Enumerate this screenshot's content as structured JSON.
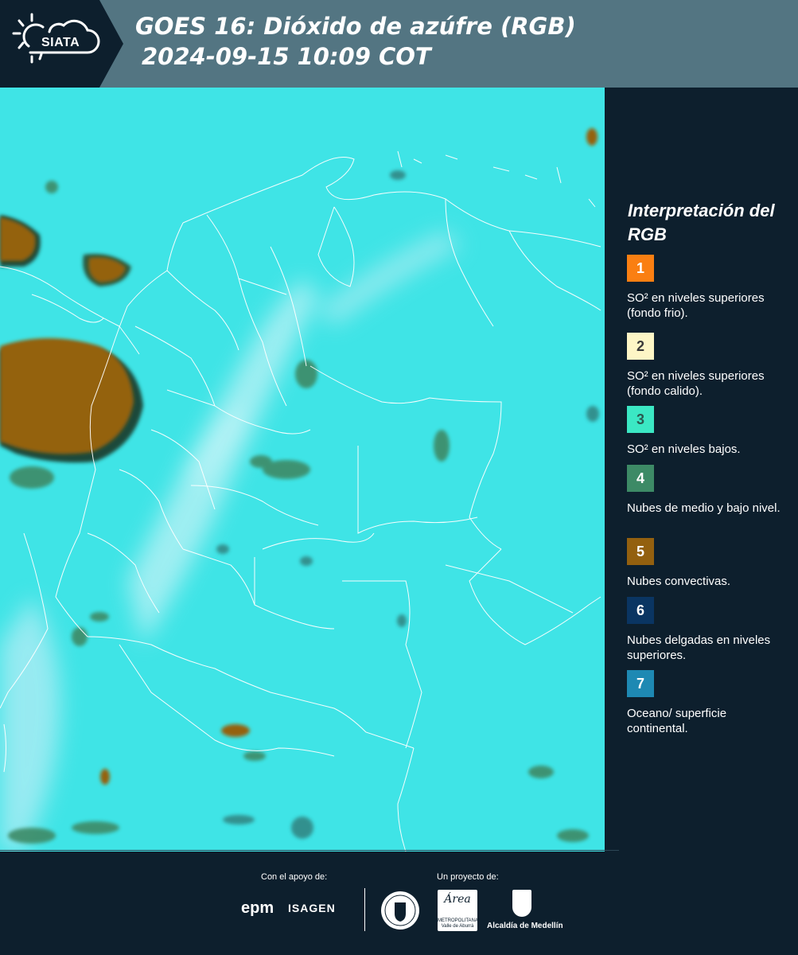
{
  "header": {
    "logo_text": "SIATA",
    "title_line1": "GOES 16: Dióxido de azúfre (RGB)",
    "title_line2": "2024-09-15 10:09 COT"
  },
  "legend": {
    "title": "Interpretación del RGB",
    "items": [
      {
        "number": "1",
        "label": "SO² en niveles superiores (fondo frio).",
        "color": "#fa7f12",
        "text_color": "#ffffff"
      },
      {
        "number": "2",
        "label": "SO² en niveles superiores (fondo calido).",
        "color": "#fdf6c6",
        "text_color": "#3a3a3a"
      },
      {
        "number": "3",
        "label": "SO² en niveles bajos.",
        "color": "#3be8c4",
        "text_color": "#2a5a50"
      },
      {
        "number": "4",
        "label": "Nubes de medio y bajo nivel.",
        "color": "#3d8a66",
        "text_color": "#ffffff"
      },
      {
        "number": "5",
        "label": "Nubes convectivas.",
        "color": "#93600f",
        "text_color": "#ffffff"
      },
      {
        "number": "6",
        "label": "Nubes delgadas en niveles superiores.",
        "color": "#0a3562",
        "text_color": "#ffffff"
      },
      {
        "number": "7",
        "label": "Oceano/ superficie continental.",
        "color": "#1e89b3",
        "text_color": "#ffffff"
      }
    ]
  },
  "footer": {
    "support_label": "Con el apoyo de:",
    "project_label": "Un proyecto de:",
    "sponsor_1": "epm",
    "sponsor_2": "ISAGEN",
    "partner_amva": "Área",
    "partner_amva_sub": "METROPOLITANA Valle de Aburrá",
    "partner_medellin": "Alcaldía de Medellín"
  },
  "map": {
    "colors": {
      "surface": "#3fe4e6",
      "convective": "#93600f",
      "mid_low_clouds": "#3d8a66",
      "thin_high_clouds": "#b8eef5"
    }
  }
}
